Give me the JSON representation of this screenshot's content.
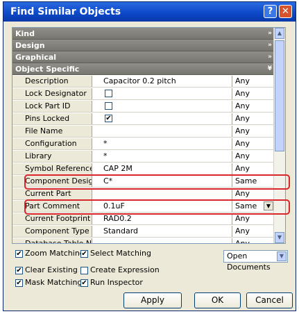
{
  "window": {
    "title": "Find Similar Objects",
    "help_glyph": "?",
    "close_glyph": "✕"
  },
  "categories": [
    {
      "label": "Kind",
      "chevron": "»"
    },
    {
      "label": "Design",
      "chevron": "»"
    },
    {
      "label": "Graphical",
      "chevron": "»"
    },
    {
      "label": "Object Specific",
      "chevron": "¥"
    }
  ],
  "rows": [
    {
      "label": "Description",
      "value": "Capacitor 0.2 pitch",
      "mode": "Any"
    },
    {
      "label": "Lock Designator",
      "value": "",
      "checked": false,
      "mode": "Any"
    },
    {
      "label": "Lock Part ID",
      "value": "",
      "checked": false,
      "mode": "Any"
    },
    {
      "label": "Pins Locked",
      "value": "",
      "checked": true,
      "mode": "Any"
    },
    {
      "label": "File Name",
      "value": "",
      "mode": "Any"
    },
    {
      "label": "Configuration",
      "value": "*",
      "mode": "Any"
    },
    {
      "label": "Library",
      "value": "*",
      "mode": "Any"
    },
    {
      "label": "Symbol Reference",
      "value": "CAP 2M",
      "mode": "Any"
    },
    {
      "label": "Component Designator",
      "value": "C*",
      "mode": "Same"
    },
    {
      "label": "Current Part",
      "value": "",
      "mode": "Any"
    },
    {
      "label": "Part Comment",
      "value": "0.1uF",
      "mode": "Same"
    },
    {
      "label": "Current Footprint",
      "value": "RAD0.2",
      "mode": "Any"
    },
    {
      "label": "Component Type",
      "value": "Standard",
      "mode": "Any"
    },
    {
      "label": "Database Table Name",
      "value": "",
      "mode": "Any"
    }
  ],
  "options": {
    "zoom_matching": {
      "label": "Zoom Matching",
      "checked": true
    },
    "select_matching": {
      "label": "Select Matching",
      "checked": true
    },
    "clear_existing": {
      "label": "Clear Existing",
      "checked": true
    },
    "create_expression": {
      "label": "Create Expression",
      "checked": false
    },
    "mask_matching": {
      "label": "Mask Matching",
      "checked": true
    },
    "run_inspector": {
      "label": "Run Inspector",
      "checked": true
    }
  },
  "scope": {
    "value": "Open Documents"
  },
  "buttons": {
    "apply": "Apply",
    "ok": "OK",
    "cancel": "Cancel"
  },
  "glyphs": {
    "check": "✔",
    "down": "▼",
    "up": "▲"
  },
  "colors": {
    "title_bar": "#0b47c7",
    "highlight": "#d9262b",
    "category": "#77766f"
  }
}
